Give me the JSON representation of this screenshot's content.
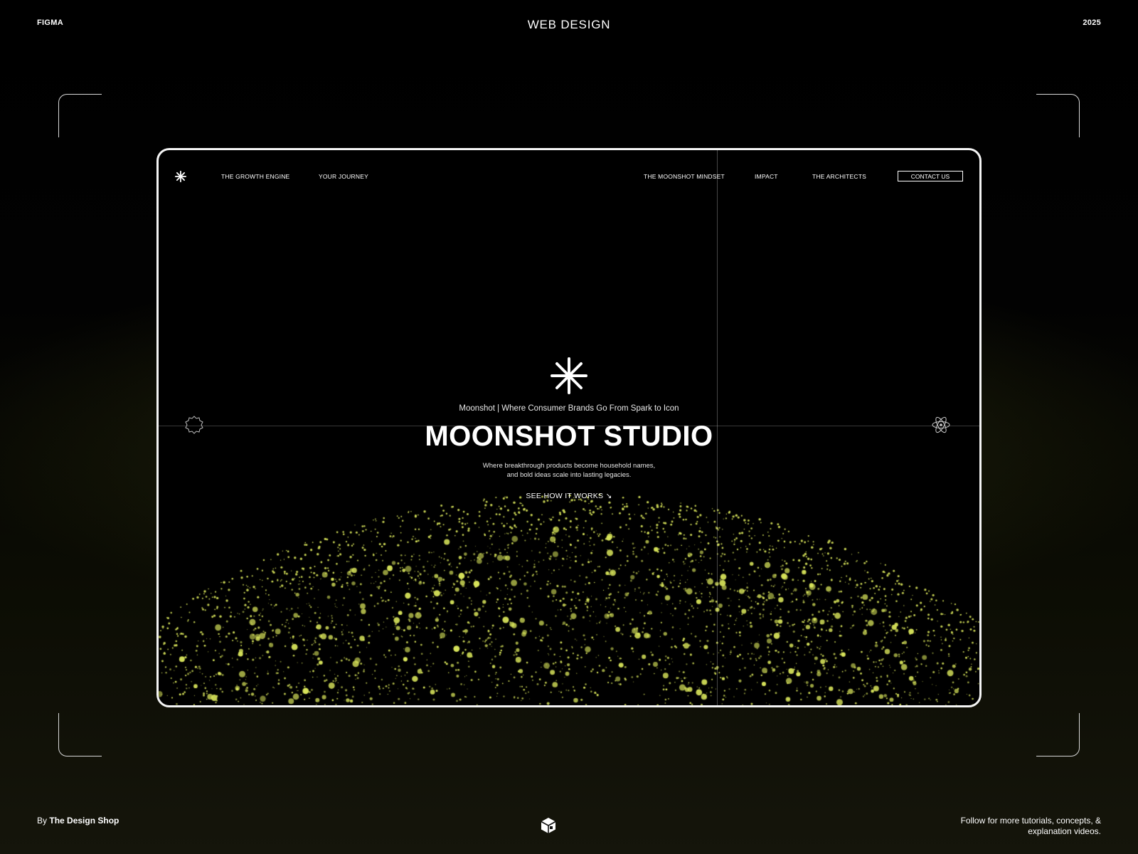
{
  "header": {
    "left_label": "FIGMA",
    "center_label": "WEB DESIGN",
    "right_label": "2025"
  },
  "site": {
    "logo_icon": "asterisk-logo-icon",
    "nav": {
      "left_items": [
        "THE GROWTH ENGINE",
        "YOUR JOURNEY"
      ],
      "right_items": [
        "THE MOONSHOT MINDSET",
        "IMPACT",
        "THE ARCHITECTS"
      ],
      "contact_label": "CONTACT US"
    },
    "hero": {
      "tagline": "Moonshot | Where Consumer Brands Go From Spark to Icon",
      "title": "MOONSHOT STUDIO",
      "description_line1": "Where breakthrough products become household names,",
      "description_line2": "and bold ideas scale into lasting legacies.",
      "cta_label": "SEE HOW IT WORKS",
      "cta_icon": "arrow-down-right-icon"
    },
    "left_icon": "badge-outline-icon",
    "right_icon": "atom-icon",
    "particle_color": "#d7e35a"
  },
  "footer": {
    "by_prefix": "By",
    "by_name": "The Design Shop",
    "right_line1": "Follow for more tutorials, concepts, &",
    "right_line2": "explanation videos.",
    "logo_icon": "cube-logo-icon"
  },
  "colors": {
    "background": "#050505",
    "accent": "#d7e35a",
    "frame_border": "#f4f4f4"
  }
}
